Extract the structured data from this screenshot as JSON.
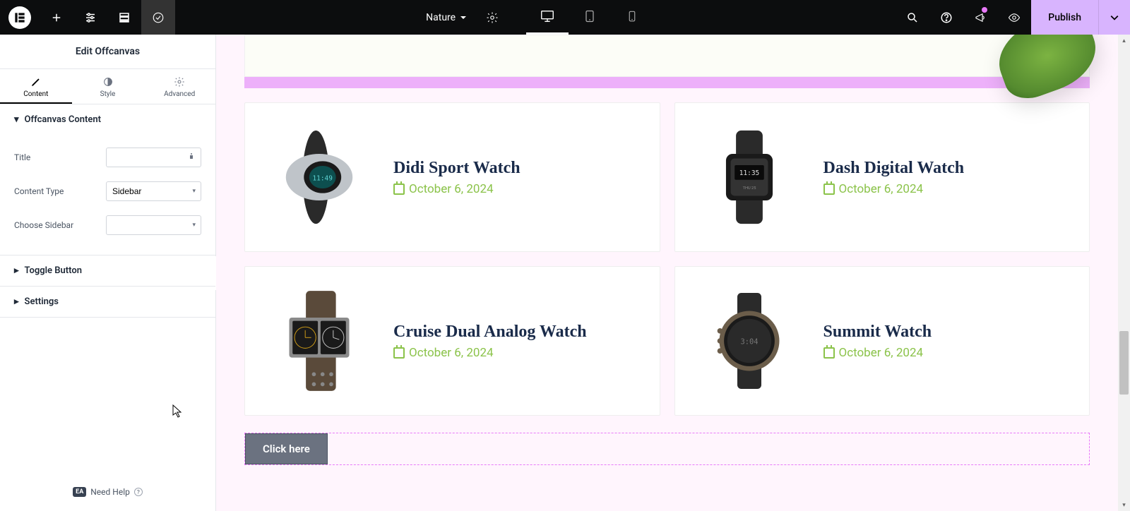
{
  "topbar": {
    "site_name": "Nature",
    "publish_label": "Publish"
  },
  "panel": {
    "title": "Edit Offcanvas",
    "tabs": {
      "content": "Content",
      "style": "Style",
      "advanced": "Advanced"
    },
    "sections": {
      "content_title": "Offcanvas Content",
      "toggle_button": "Toggle Button",
      "settings": "Settings"
    },
    "fields": {
      "title_label": "Title",
      "title_value": "",
      "content_type_label": "Content Type",
      "content_type_value": "Sidebar",
      "choose_sidebar_label": "Choose Sidebar",
      "choose_sidebar_value": ""
    },
    "need_help": "Need Help",
    "ea_badge": "EA"
  },
  "canvas": {
    "products": [
      {
        "title": "Didi Sport Watch",
        "date": "October 6, 2024"
      },
      {
        "title": "Dash Digital Watch",
        "date": "October 6, 2024"
      },
      {
        "title": "Cruise Dual Analog Watch",
        "date": "October 6, 2024"
      },
      {
        "title": "Summit Watch",
        "date": "October 6, 2024"
      }
    ],
    "click_here": "Click here"
  }
}
